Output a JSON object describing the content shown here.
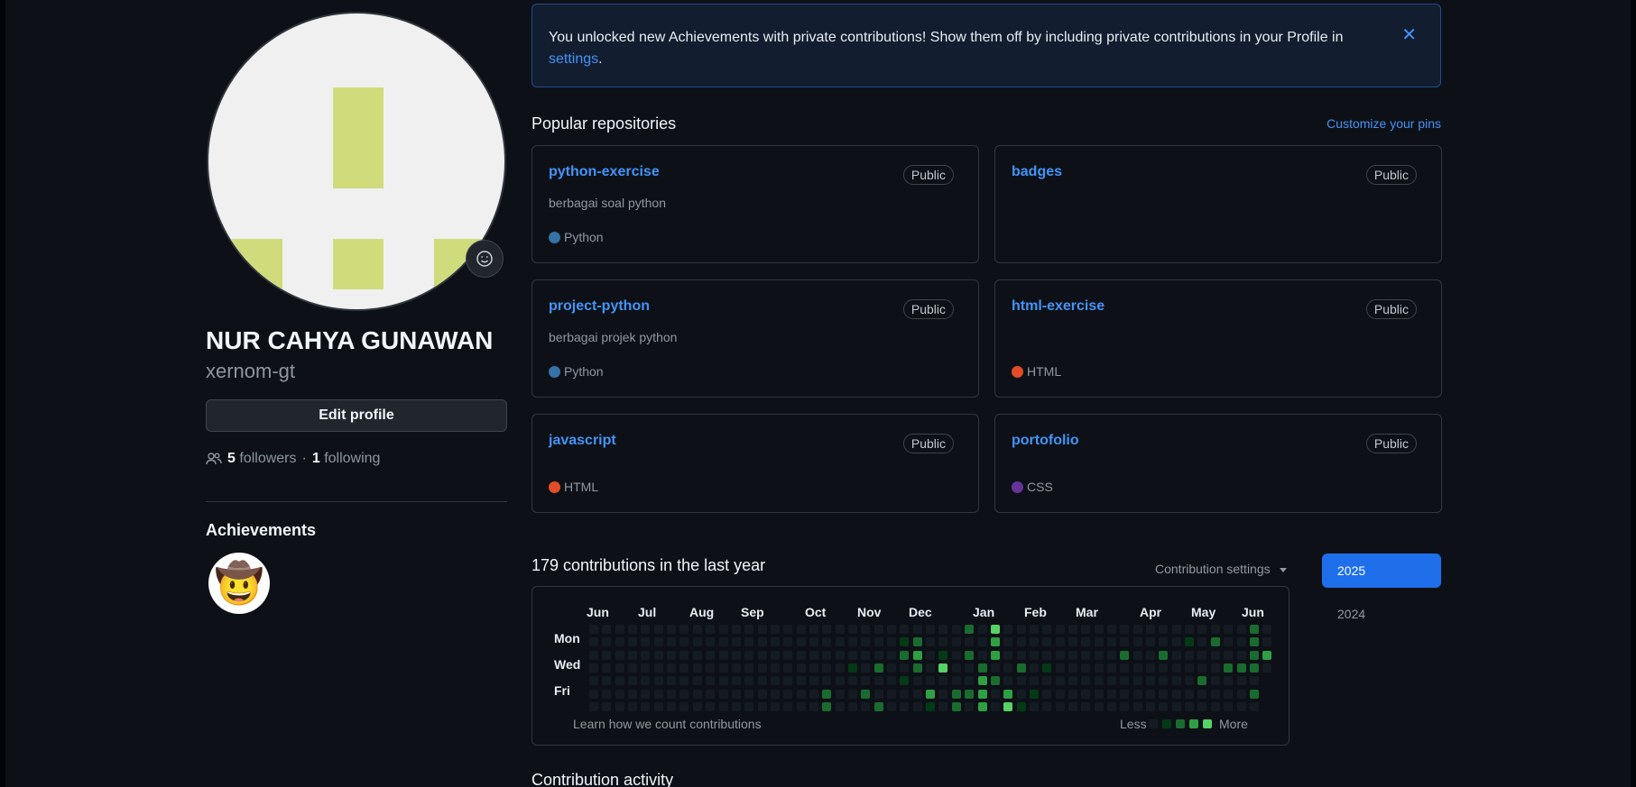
{
  "profile": {
    "name": "NUR CAHYA GUNAWAN",
    "login": "xernom-gt",
    "edit_label": "Edit profile",
    "followers_count": "5",
    "followers_label": "followers",
    "dot": "·",
    "following_count": "1",
    "following_label": "following",
    "achievements_title": "Achievements",
    "achievement_badge": "🤠"
  },
  "banner": {
    "text": "You unlocked new Achievements with private contributions! Show them off by including private contributions in your Profile in",
    "link_label": "settings",
    "period": ".",
    "close_glyph": "✕"
  },
  "popular": {
    "title": "Popular repositories",
    "customize_label": "Customize your pins",
    "repos": [
      {
        "name": "python-exercise",
        "visibility": "Public",
        "description": "berbagai soal python",
        "language": "Python",
        "lang_color": "#3572A5"
      },
      {
        "name": "badges",
        "visibility": "Public",
        "description": "",
        "language": "",
        "lang_color": ""
      },
      {
        "name": "project-python",
        "visibility": "Public",
        "description": "berbagai projek python",
        "language": "Python",
        "lang_color": "#3572A5"
      },
      {
        "name": "html-exercise",
        "visibility": "Public",
        "description": "",
        "language": "HTML",
        "lang_color": "#e34c26"
      },
      {
        "name": "javascript",
        "visibility": "Public",
        "description": "",
        "language": "HTML",
        "lang_color": "#e34c26"
      },
      {
        "name": "portofolio",
        "visibility": "Public",
        "description": "",
        "language": "CSS",
        "lang_color": "#663399"
      }
    ]
  },
  "contributions": {
    "title": "179 contributions in the last year",
    "settings_label": "Contribution settings",
    "months": [
      "Jun",
      "Jul",
      "Aug",
      "Sep",
      "Oct",
      "Nov",
      "Dec",
      "Jan",
      "Feb",
      "Mar",
      "Apr",
      "May",
      "Jun"
    ],
    "days": [
      "Mon",
      "Wed",
      "Fri"
    ],
    "learn_label": "Learn how we count contributions",
    "less_label": "Less",
    "more_label": "More",
    "years": [
      "2025",
      "2024"
    ]
  },
  "activity": {
    "title": "Contribution activity"
  },
  "colors": {
    "accent": "#4493f8",
    "active_year": "#1f6feb",
    "graph_levels": [
      "#151b23",
      "#033a16",
      "#196c2e",
      "#2ea043",
      "#56d364"
    ]
  }
}
